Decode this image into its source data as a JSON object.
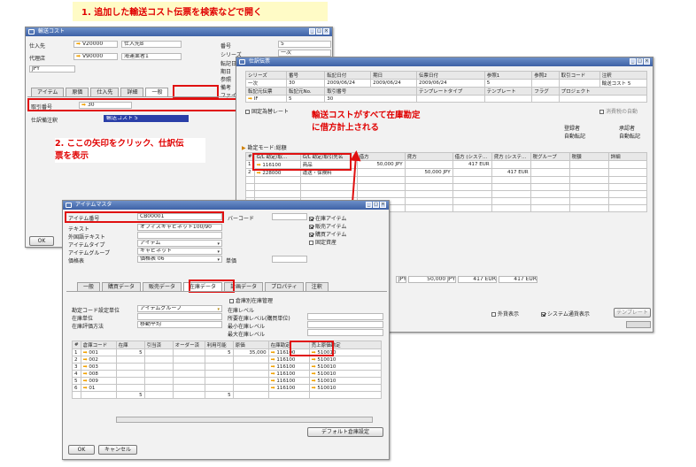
{
  "banner": {
    "step1": "1. 追加した輸送コスト伝票を検索などで開く"
  },
  "win1": {
    "title": "輸送コスト",
    "vendor_label": "仕入先",
    "vendor_code": "V20000",
    "vendor_name_label": "仕入先B",
    "agent_label": "代理店",
    "agent_code": "V90000",
    "agent_name": "海運業者1",
    "currency": "JPY",
    "num_label": "番号",
    "num_value": "5",
    "series_label": "シリーズ",
    "series_value": "一次",
    "side_labels": [
      "転記日",
      "期日",
      "参照",
      "備考",
      "ファイル"
    ],
    "tabs": [
      "アイテム",
      "原価",
      "仕入先",
      "詳細",
      "一般"
    ],
    "je_label": "取引番号",
    "je_value": "30",
    "journal_label": "仕訳備注釈",
    "journal_value": "輸送コスト 5",
    "ok": "OK"
  },
  "annot2": [
    "2. ここの矢印をクリック、仕訳伝",
    "票を表示"
  ],
  "win2": {
    "title": "仕訳伝票",
    "head_cols": [
      "シリーズ",
      "番号",
      "転記日付",
      "期日",
      "伝票日付",
      "参照1",
      "参照2",
      "取引コード",
      "注釈"
    ],
    "head_vals": [
      "一次",
      "30",
      "2009/06/24",
      "2009/06/24",
      "2009/06/24",
      "5",
      "",
      "",
      "輸送コスト 5"
    ],
    "row2_labels": [
      "転記元伝票",
      "転記元No.",
      "取引番号",
      "テンプレートタイプ",
      "テンプレート",
      "フラグ",
      "プロジェクト"
    ],
    "row2_vals": [
      "IF",
      "5",
      "30"
    ],
    "fixed_rate": "固定為替レート",
    "reverse": "消費税の自動",
    "mode_label": "勘定モード:総額",
    "right_labels": [
      "登録者",
      "承認者",
      "自動転記",
      "自動転記"
    ],
    "grid_headers": [
      "#",
      "G/L 勘定/取...",
      "G/L 勘定/取引先名",
      "借方",
      "貸方",
      "借方 (システ...",
      "貸方 (システ...",
      "税グループ",
      "税額",
      "詳細"
    ],
    "grid_rows": [
      [
        "1",
        "116100",
        "商品",
        "50,000 JPY",
        "",
        "417 EUR",
        "",
        "",
        "",
        ""
      ],
      [
        "2",
        "228000",
        "運送・保険料",
        "",
        "50,000 JPY",
        "",
        "417 EUR",
        "",
        "",
        ""
      ]
    ],
    "totals": [
      "JPY",
      "50,000 JPY",
      "417 EUR",
      "417 EUR"
    ],
    "foreign": "外貨表示",
    "sysccy": "システム通貨表示",
    "template_btn": "テンプレート"
  },
  "annot3": [
    "輸送コストがすべて在庫勘定",
    "に借方計上される"
  ],
  "win3": {
    "title": "アイテムマスタ",
    "item_no_label": "アイテム番号",
    "item_no_value": "CB00001",
    "desc_label": "テキスト",
    "desc_value": "オフィスキャビネット100/90",
    "foreign_label": "外国語テキスト",
    "type_label": "アイテムタイプ",
    "type_value": "アイテム",
    "group_label": "アイテムグループ",
    "group_value": "キャビネット",
    "price_label": "価格表",
    "price_value": "価格表 06",
    "unit_label": "単価",
    "barcode_label": "バーコード",
    "checks": [
      "在庫アイテム",
      "販売アイテム",
      "購買アイテム",
      "固定資産"
    ],
    "tabs": [
      "一般",
      "購買データ",
      "販売データ",
      "在庫データ",
      "計画データ",
      "プロパティ",
      "注釈"
    ],
    "manage_wh": "倉庫別在庫管理",
    "gl_method_label": "勘定コード設定単位",
    "gl_method_value": "アイテムグループ",
    "inv_uom_label": "在庫単位",
    "valuation_label": "在庫評価方法",
    "valuation_value": "移動平均",
    "right_labels": [
      "在庫レベル",
      "所要在庫レベル(購買単位)",
      "最小在庫レベル",
      "最大在庫レベル"
    ],
    "grid_headers": [
      "#",
      "倉庫コード",
      "在庫",
      "引当済",
      "オーダー済",
      "利用可能",
      "原価",
      "在庫勘定",
      "売上原価勘定"
    ],
    "grid_rows": [
      [
        "1",
        "001",
        "5",
        "",
        "",
        "5",
        "35,000",
        "116100",
        "510010"
      ],
      [
        "2",
        "002",
        "",
        "",
        "",
        "",
        "",
        "116100",
        "510010"
      ],
      [
        "3",
        "003",
        "",
        "",
        "",
        "",
        "",
        "116100",
        "510010"
      ],
      [
        "4",
        "008",
        "",
        "",
        "",
        "",
        "",
        "116100",
        "510010"
      ],
      [
        "5",
        "009",
        "",
        "",
        "",
        "",
        "",
        "116100",
        "510010"
      ],
      [
        "6",
        "01",
        "",
        "",
        "",
        "",
        "",
        "116100",
        "510010"
      ]
    ],
    "total_stock": "5",
    "total_avail": "5",
    "default_wh_btn": "デフォルト倉庫設定",
    "ok": "OK",
    "cancel": "キャンセル"
  }
}
